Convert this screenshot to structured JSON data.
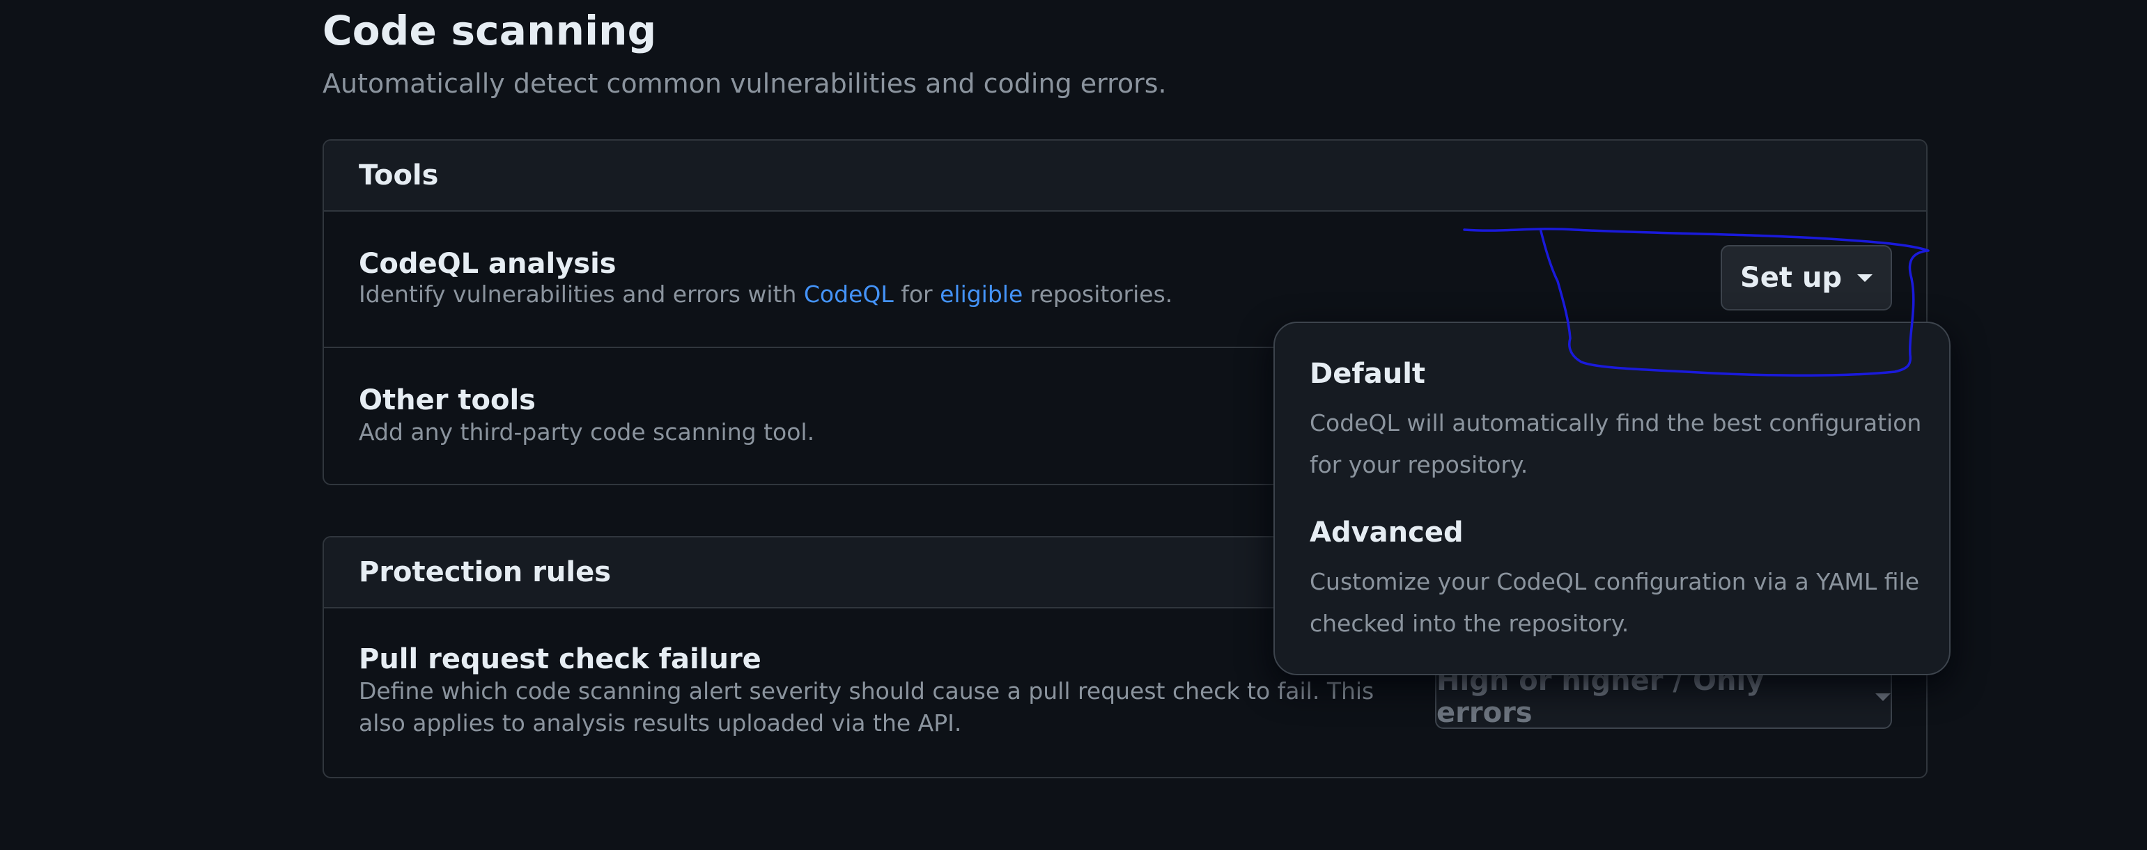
{
  "page": {
    "title": "Code scanning",
    "subtitle": "Automatically detect common vulnerabilities and coding errors."
  },
  "tools": {
    "header": "Tools",
    "codeql": {
      "title": "CodeQL analysis",
      "desc_prefix": "Identify vulnerabilities and errors with ",
      "link_codeql": "CodeQL",
      "desc_mid": " for ",
      "link_eligible": "eligible",
      "desc_suffix": " repositories.",
      "button_label": "Set up"
    },
    "other": {
      "title": "Other tools",
      "desc": "Add any third-party code scanning tool."
    }
  },
  "protection": {
    "header": "Protection rules",
    "pr_check": {
      "title": "Pull request check failure",
      "desc": "Define which code scanning alert severity should cause a pull request check to fail. This also applies to analysis results uploaded via the API.",
      "select_value": "High or higher / Only errors"
    }
  },
  "setup_menu": {
    "default": {
      "title": "Default",
      "desc": "CodeQL will automatically find the best configuration for your repository."
    },
    "advanced": {
      "title": "Advanced",
      "desc": "Customize your CodeQL configuration via a YAML file checked into the repository."
    }
  },
  "colors": {
    "background": "#0d1117",
    "panel": "#161b22",
    "border": "#30363d",
    "link": "#4493f8",
    "annotation": "#1a1adb"
  },
  "icons": {
    "dropdown_caret": "triangle-down-icon"
  }
}
